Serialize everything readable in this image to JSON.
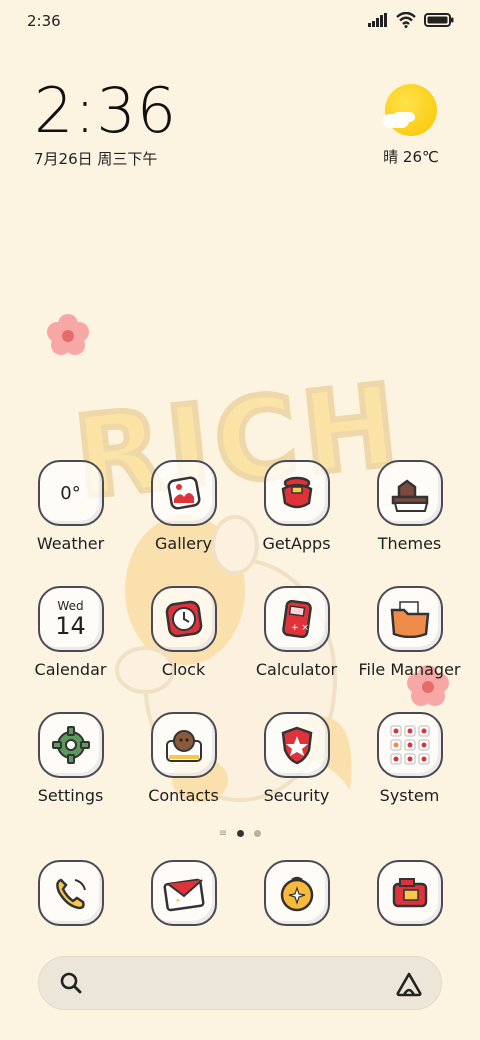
{
  "status_bar": {
    "time": "2:36"
  },
  "clock_widget": {
    "time": "2:36",
    "date": "7月26日 周三下午"
  },
  "weather_widget": {
    "text": "晴 26℃"
  },
  "wallpaper": {
    "word": "RICH"
  },
  "apps": [
    {
      "label": "Weather",
      "icon": "weather-icon",
      "badge": "0°"
    },
    {
      "label": "Gallery",
      "icon": "gallery-icon"
    },
    {
      "label": "GetApps",
      "icon": "getapps-icon"
    },
    {
      "label": "Themes",
      "icon": "themes-icon"
    },
    {
      "label": "Calendar",
      "icon": "calendar-icon",
      "day": "Wed",
      "date": "14"
    },
    {
      "label": "Clock",
      "icon": "clock-icon"
    },
    {
      "label": "Calculator",
      "icon": "calculator-icon"
    },
    {
      "label": "File Manager",
      "icon": "folder-icon"
    },
    {
      "label": "Settings",
      "icon": "gear-icon"
    },
    {
      "label": "Contacts",
      "icon": "contacts-icon"
    },
    {
      "label": "Security",
      "icon": "shield-icon"
    },
    {
      "label": "System",
      "icon": "system-folder-icon"
    }
  ],
  "page_indicator": {
    "pages": 2,
    "current": 1
  },
  "dock": [
    {
      "icon": "phone-icon"
    },
    {
      "icon": "messages-icon"
    },
    {
      "icon": "browser-icon"
    },
    {
      "icon": "camera-icon"
    }
  ],
  "colors": {
    "background": "#fdf3e1",
    "accent_red": "#e0323a",
    "accent_orange": "#ef8c4a",
    "accent_green": "#5a9a5a"
  }
}
